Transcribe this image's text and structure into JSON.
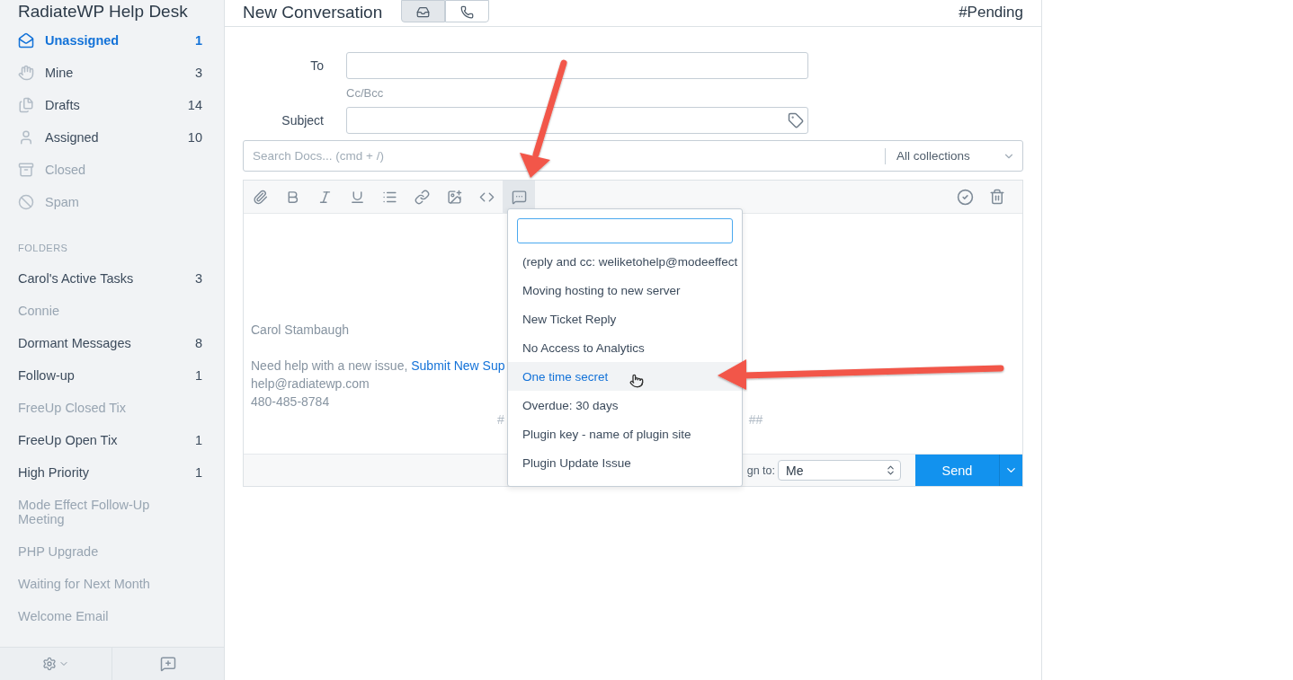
{
  "sidebar": {
    "title": "RadiateWP Help Desk",
    "mailboxes": [
      {
        "label": "Unassigned",
        "count": "1",
        "selected": true,
        "dimmed": false
      },
      {
        "label": "Mine",
        "count": "3",
        "selected": false,
        "dimmed": false
      },
      {
        "label": "Drafts",
        "count": "14",
        "selected": false,
        "dimmed": false
      },
      {
        "label": "Assigned",
        "count": "10",
        "selected": false,
        "dimmed": false
      },
      {
        "label": "Closed",
        "selected": false,
        "dimmed": true
      },
      {
        "label": "Spam",
        "selected": false,
        "dimmed": true
      }
    ],
    "folders_heading": "FOLDERS",
    "folders": [
      {
        "label": "Carol's Active Tasks",
        "count": "3",
        "dimmed": false
      },
      {
        "label": "Connie",
        "dimmed": true
      },
      {
        "label": "Dormant Messages",
        "count": "8",
        "dimmed": false
      },
      {
        "label": "Follow-up",
        "count": "1",
        "dimmed": false
      },
      {
        "label": "FreeUp Closed Tix",
        "dimmed": true
      },
      {
        "label": "FreeUp Open Tix",
        "count": "1",
        "dimmed": false
      },
      {
        "label": "High Priority",
        "count": "1",
        "dimmed": false
      },
      {
        "label": "Mode Effect Follow-Up Meeting",
        "dimmed": true
      },
      {
        "label": "PHP Upgrade",
        "dimmed": true
      },
      {
        "label": "Waiting for Next Month",
        "dimmed": true
      },
      {
        "label": "Welcome Email",
        "dimmed": true
      }
    ]
  },
  "header": {
    "title": "New Conversation",
    "status": "#Pending",
    "compose_types": [
      {
        "kind": "email",
        "selected": true
      },
      {
        "kind": "phone",
        "selected": false
      }
    ]
  },
  "form": {
    "to_label": "To",
    "cc_bcc": "Cc/Bcc",
    "subject_label": "Subject"
  },
  "docs_search": {
    "placeholder": "Search Docs... (cmd + /)",
    "collection": "All collections"
  },
  "editor": {
    "signature": {
      "name": "Carol Stambaugh",
      "help_text": "Need help with a new issue, ",
      "help_link": "Submit New Sup",
      "email": "help@radiatewp.com",
      "phone": "480-485-8784"
    },
    "marker_left": "#",
    "marker_right": "##",
    "assign_label": "gn to:",
    "assign_value": "Me",
    "send": "Send"
  },
  "saved_replies": [
    {
      "label": "(reply and cc: weliketohelp@modeeffect",
      "selected": false
    },
    {
      "label": "Moving hosting to new server",
      "selected": false
    },
    {
      "label": "New Ticket Reply",
      "selected": false
    },
    {
      "label": "No Access to Analytics",
      "selected": false
    },
    {
      "label": "One time secret",
      "selected": true
    },
    {
      "label": "Overdue: 30 days",
      "selected": false
    },
    {
      "label": "Plugin key - name of plugin site",
      "selected": false
    },
    {
      "label": "Plugin Update Issue",
      "selected": false
    }
  ]
}
